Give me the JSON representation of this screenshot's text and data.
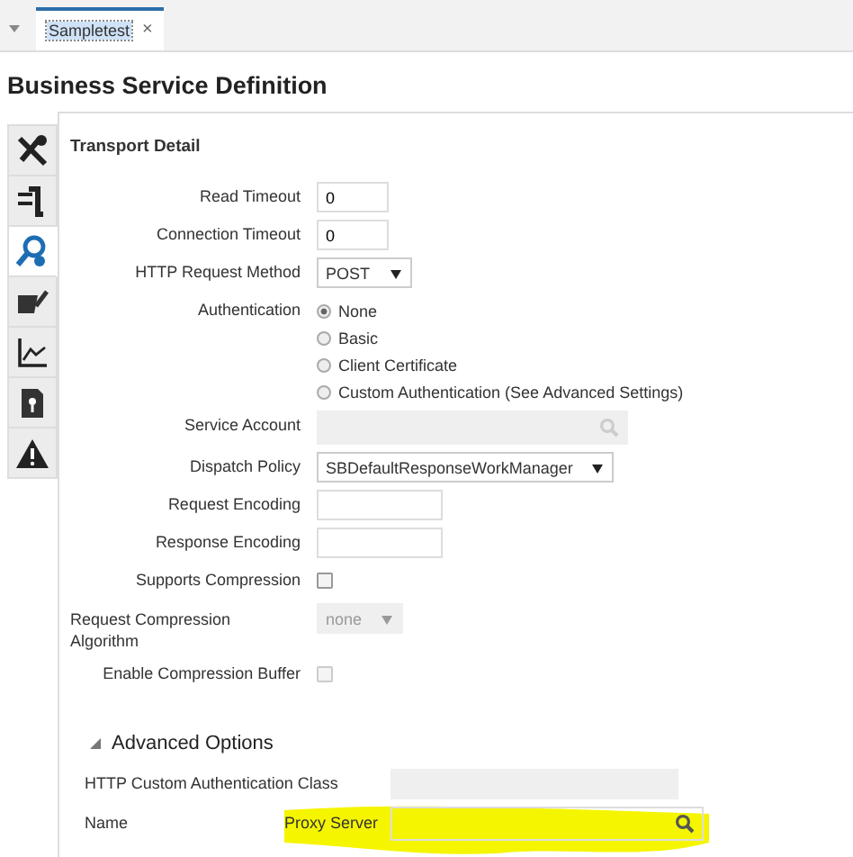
{
  "tab_bar": {
    "tabs": [
      {
        "label": "Sampletest",
        "selected": true,
        "close": "×"
      }
    ]
  },
  "title": "Business Service Definition",
  "side_tabs": [
    {
      "kind": "tools",
      "selected": false
    },
    {
      "kind": "plug",
      "selected": false
    },
    {
      "kind": "search",
      "selected": true
    },
    {
      "kind": "config",
      "selected": false
    },
    {
      "kind": "chart",
      "selected": false
    },
    {
      "kind": "document",
      "selected": false
    },
    {
      "kind": "warning",
      "selected": false
    }
  ],
  "section_title": "Transport Detail",
  "fields": [
    {
      "kind": "number",
      "label": "Read Timeout",
      "value": "0"
    },
    {
      "kind": "number",
      "label": "Connection Timeout",
      "value": "0"
    },
    {
      "kind": "select",
      "label": "HTTP Request Method",
      "value": "POST"
    },
    {
      "kind": "radio",
      "label": "Authentication",
      "options": [
        {
          "label": "None",
          "selected": true
        },
        {
          "label": "Basic",
          "selected": false
        },
        {
          "label": "Client Certificate",
          "selected": false
        },
        {
          "label": "Custom Authentication (See Advanced Settings)",
          "selected": false
        }
      ]
    },
    {
      "kind": "search",
      "label": "Service Account",
      "disabled": true
    },
    {
      "kind": "select",
      "label": "Dispatch Policy",
      "value": "SBDefaultResponseWorkManager"
    },
    {
      "kind": "text",
      "label": "Request Encoding"
    },
    {
      "kind": "text",
      "label": "Response Encoding"
    },
    {
      "kind": "checkbox",
      "label": "Supports Compression",
      "checked": false
    },
    {
      "kind": "select",
      "label": "Request Compression Algorithm",
      "value": "none",
      "disabled": true,
      "wide_label": true
    },
    {
      "kind": "checkbox",
      "label": "Enable Compression Buffer",
      "checked": false,
      "disabled": true
    }
  ],
  "advanced": {
    "title": "Advanced Options",
    "expanded": true,
    "fields": [
      {
        "kind": "text",
        "label": "HTTP Custom Authentication Class",
        "disabled": true
      },
      {
        "kind": "search",
        "label": "Name",
        "prefix": "Proxy Server",
        "highlighted": true
      }
    ]
  }
}
